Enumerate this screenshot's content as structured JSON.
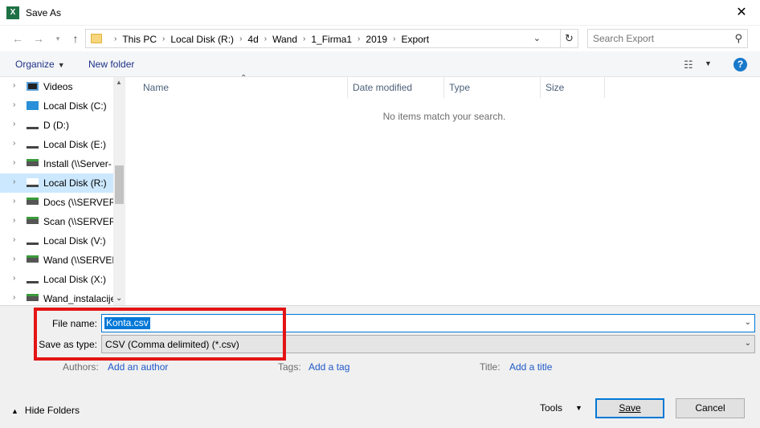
{
  "window": {
    "title": "Save As",
    "app_icon": "X"
  },
  "nav": {
    "breadcrumbs": [
      "This PC",
      "Local Disk (R:)",
      "4d",
      "Wand",
      "1_Firma1",
      "2019",
      "Export"
    ],
    "search_placeholder": "Search Export"
  },
  "toolbar": {
    "organize": "Organize",
    "new_folder": "New folder"
  },
  "tree": [
    {
      "label": "Videos",
      "icon": "video-icon"
    },
    {
      "label": "Local Disk (C:)",
      "icon": "windows-drive-icon"
    },
    {
      "label": "D (D:)",
      "icon": "drive-icon"
    },
    {
      "label": "Local Disk (E:)",
      "icon": "drive-icon"
    },
    {
      "label": "Install (\\\\Server-",
      "icon": "network-drive-icon"
    },
    {
      "label": "Local Disk (R:)",
      "icon": "drive-icon",
      "selected": true
    },
    {
      "label": "Docs (\\\\SERVER-",
      "icon": "network-drive-icon"
    },
    {
      "label": "Scan (\\\\SERVER-",
      "icon": "network-drive-icon"
    },
    {
      "label": "Local Disk (V:)",
      "icon": "drive-icon"
    },
    {
      "label": "Wand (\\\\SERVER",
      "icon": "network-drive-icon"
    },
    {
      "label": "Local Disk (X:)",
      "icon": "drive-icon"
    },
    {
      "label": "Wand_instalacije",
      "icon": "network-drive-icon"
    }
  ],
  "columns": {
    "name": "Name",
    "date": "Date modified",
    "type": "Type",
    "size": "Size"
  },
  "empty_message": "No items match your search.",
  "form": {
    "file_name_label": "File name:",
    "file_name_value": "Konta.csv",
    "save_type_label": "Save as type:",
    "save_type_value": "CSV (Comma delimited) (*.csv)",
    "authors_label": "Authors:",
    "authors_link": "Add an author",
    "tags_label": "Tags:",
    "tags_link": "Add a tag",
    "title_label": "Title:",
    "title_link": "Add a title"
  },
  "footer": {
    "hide_folders": "Hide Folders",
    "tools": "Tools",
    "save": "Save",
    "cancel": "Cancel"
  },
  "colors": {
    "accent": "#0078d7",
    "highlight": "#e41414",
    "selection": "#cce8ff"
  }
}
